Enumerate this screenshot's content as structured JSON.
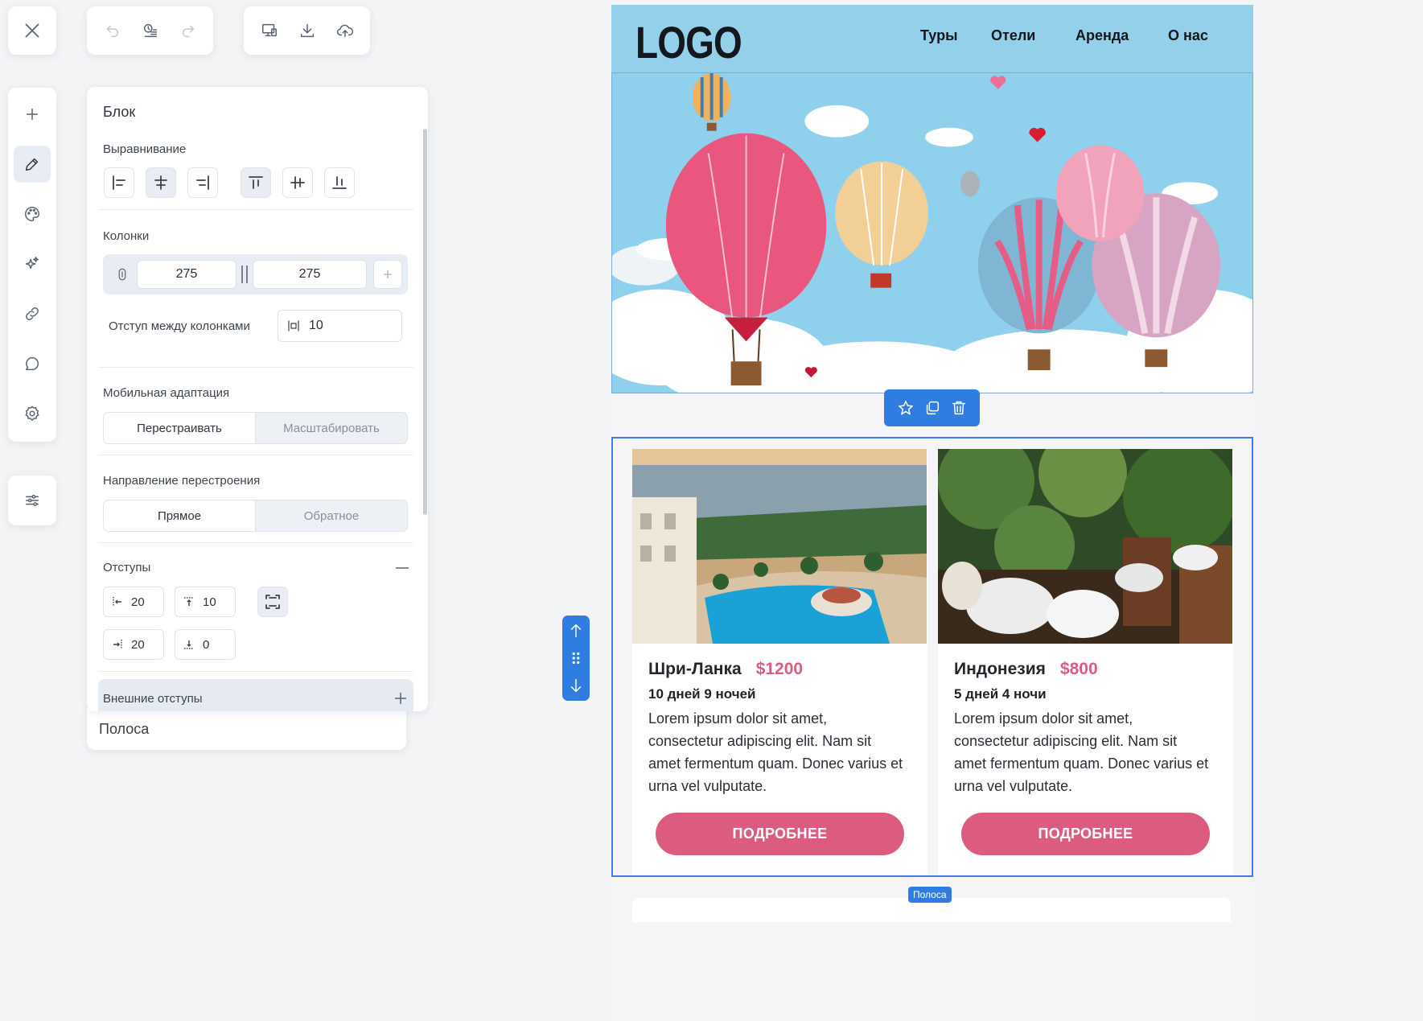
{
  "panel": {
    "title": "Блок",
    "alignment_label": "Выравнивание",
    "columns_label": "Колонки",
    "column_widths": [
      "275",
      "275"
    ],
    "gap_label": "Отступ между колонками",
    "gap_value": "10",
    "mobile_label": "Мобильная адаптация",
    "mobile_options": [
      "Перестраивать",
      "Масштабировать"
    ],
    "direction_label": "Направление перестроения",
    "direction_options": [
      "Прямое",
      "Обратное"
    ],
    "padding_label": "Отступы",
    "padding": {
      "left": "20",
      "top": "10",
      "right": "20",
      "bottom": "0"
    },
    "margins_label": "Внешние отступы",
    "strip_tab": "Полоса"
  },
  "toolbar": {
    "items": [
      "plus-icon",
      "pencil-icon",
      "palette-icon",
      "sparkles-icon",
      "link-icon",
      "comment-icon",
      "gear-icon"
    ],
    "active": "pencil-icon"
  },
  "site": {
    "logo": "LOGO",
    "nav": [
      "Туры",
      "Отели",
      "Аренда",
      "О нас"
    ],
    "header_color": "#95d0ea"
  },
  "tours": [
    {
      "title": "Шри-Ланка",
      "price": "$1200",
      "duration": "10 дней 9 ночей",
      "description": "Lorem ipsum dolor sit amet, consectetur adipiscing elit. Nam sit amet fermentum quam. Donec varius et urna vel vulputate.",
      "button": "ПОДРОБНЕЕ"
    },
    {
      "title": "Индонезия",
      "price": "$800",
      "duration": "5 дней 4 ночи",
      "description": "Lorem ipsum dolor sit amet, consectetur adipiscing elit. Nam sit amet fermentum quam. Donec varius et urna vel vulputate.",
      "button": "ПОДРОБНЕЕ"
    }
  ],
  "strip_badge": "Полоса",
  "colors": {
    "accent": "#2f7de1",
    "price": "#db5c7f",
    "button": "#dc5c80"
  }
}
